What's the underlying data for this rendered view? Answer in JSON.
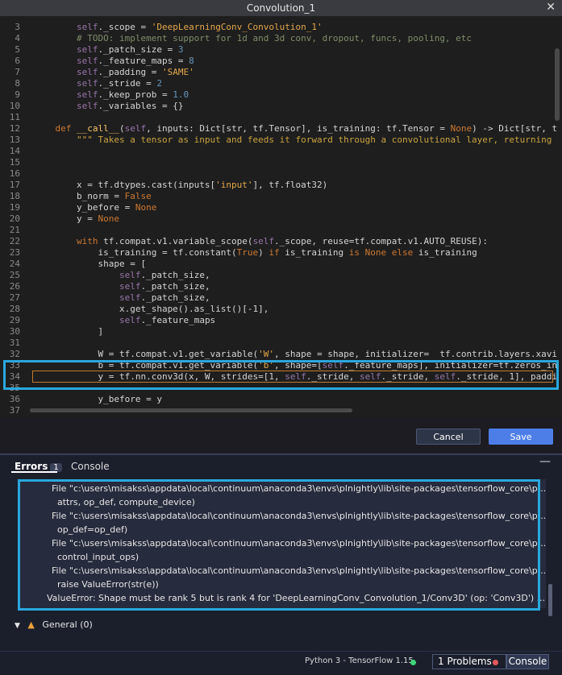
{
  "window": {
    "title": "Convolution_1",
    "close_glyph": "✕"
  },
  "editor": {
    "lines": [
      {
        "n": "3",
        "t": "        self._scope = 'DeepLearningConv_Convolution_1'"
      },
      {
        "n": "4",
        "t": "        # TODO: implement support for 1d and 3d conv, dropout, funcs, pooling, etc"
      },
      {
        "n": "5",
        "t": "        self._patch_size = 3"
      },
      {
        "n": "6",
        "t": "        self._feature_maps = 8"
      },
      {
        "n": "7",
        "t": "        self._padding = 'SAME'"
      },
      {
        "n": "8",
        "t": "        self._stride = 2"
      },
      {
        "n": "9",
        "t": "        self._keep_prob = 1.0"
      },
      {
        "n": "10",
        "t": "        self._variables = {}"
      },
      {
        "n": "11",
        "t": ""
      },
      {
        "n": "12",
        "t": "    def __call__(self, inputs: Dict[str, tf.Tensor], is_training: tf.Tensor = None) -> Dict[str, t"
      },
      {
        "n": "13",
        "t": "        \"\"\" Takes a tensor as input and feeds it forward through a convolutional layer, returning"
      },
      {
        "n": "14",
        "t": ""
      },
      {
        "n": "15",
        "t": ""
      },
      {
        "n": "16",
        "t": ""
      },
      {
        "n": "17",
        "t": "        x = tf.dtypes.cast(inputs['input'], tf.float32)"
      },
      {
        "n": "18",
        "t": "        b_norm = False"
      },
      {
        "n": "19",
        "t": "        y_before = None"
      },
      {
        "n": "20",
        "t": "        y = None"
      },
      {
        "n": "21",
        "t": ""
      },
      {
        "n": "22",
        "t": "        with tf.compat.v1.variable_scope(self._scope, reuse=tf.compat.v1.AUTO_REUSE):"
      },
      {
        "n": "23",
        "t": "            is_training = tf.constant(True) if is_training is None else is_training"
      },
      {
        "n": "24",
        "t": "            shape = ["
      },
      {
        "n": "25",
        "t": "                self._patch_size,"
      },
      {
        "n": "26",
        "t": "                self._patch_size,"
      },
      {
        "n": "27",
        "t": "                self._patch_size,"
      },
      {
        "n": "28",
        "t": "                x.get_shape().as_list()[-1],"
      },
      {
        "n": "29",
        "t": "                self._feature_maps"
      },
      {
        "n": "30",
        "t": "            ]"
      },
      {
        "n": "31",
        "t": ""
      },
      {
        "n": "32",
        "t": "            W = tf.compat.v1.get_variable('W', shape = shape, initializer=  tf.contrib.layers.xavi"
      },
      {
        "n": "33",
        "t": "            b = tf.compat.v1.get_variable('b', shape=[self._feature_maps], initializer=tf.zeros_in"
      },
      {
        "n": "34",
        "t": "            y = tf.nn.conv3d(x, W, strides=[1, self._stride, self._stride, self._stride, 1], paddi"
      },
      {
        "n": "35",
        "t": ""
      },
      {
        "n": "36",
        "t": "            y_before = y"
      },
      {
        "n": "37",
        "t": ""
      }
    ]
  },
  "buttons": {
    "cancel": "Cancel",
    "save": "Save"
  },
  "panel": {
    "tabs": {
      "errors": "Errors",
      "errors_count": "1",
      "console": "Console"
    },
    "minimize_glyph": "—",
    "error_lines": [
      "File \"c:\\users\\misakss\\appdata\\local\\continuum\\anaconda3\\envs\\plnightly\\lib\\site-packages\\tensorflow_core\\p...",
      "  attrs, op_def, compute_device)",
      "File \"c:\\users\\misakss\\appdata\\local\\continuum\\anaconda3\\envs\\plnightly\\lib\\site-packages\\tensorflow_core\\p...",
      "  op_def=op_def)",
      "File \"c:\\users\\misakss\\appdata\\local\\continuum\\anaconda3\\envs\\plnightly\\lib\\site-packages\\tensorflow_core\\p...",
      "  control_input_ops)",
      "File \"c:\\users\\misakss\\appdata\\local\\continuum\\anaconda3\\envs\\plnightly\\lib\\site-packages\\tensorflow_core\\p...",
      "  raise ValueError(str(e))",
      "ValueError: Shape must be rank 5 but is rank 4 for 'DeepLearningConv_Convolution_1/Conv3D' (op: 'Conv3D') ..."
    ],
    "general": "General (0)"
  },
  "status": {
    "python": "Python 3 - TensorFlow 1.15",
    "problems": "1 Problems",
    "console": "Console"
  },
  "colors": {
    "accent": "#29a8de",
    "save": "#4d7ee8",
    "ok_dot": "#3fd57a",
    "err_dot": "#e25959"
  }
}
